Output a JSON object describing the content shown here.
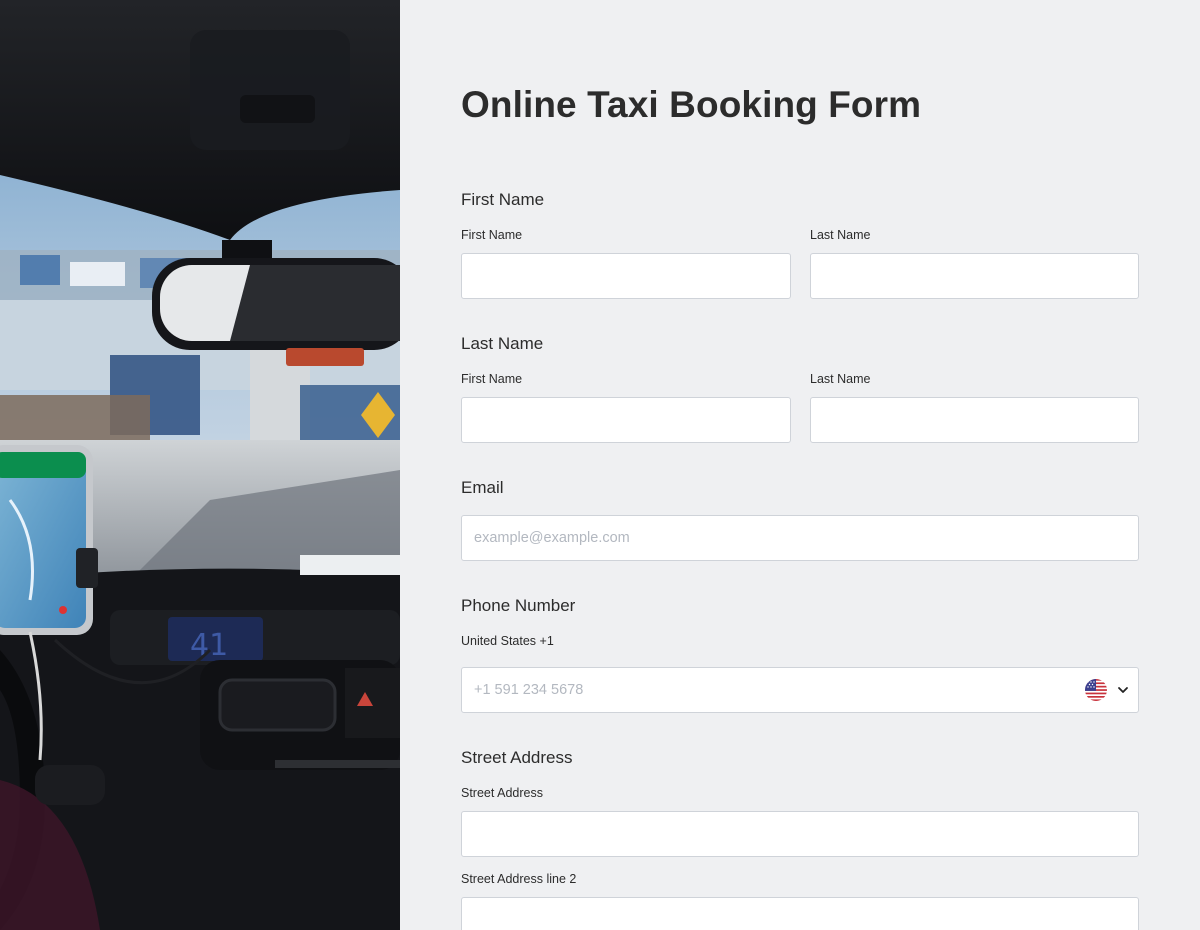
{
  "form": {
    "title": "Online Taxi Booking Form",
    "first_name_group": {
      "label": "First Name",
      "first_sublabel": "First Name",
      "last_sublabel": "Last Name",
      "first_value": "",
      "last_value": ""
    },
    "last_name_group": {
      "label": "Last Name",
      "first_sublabel": "First Name",
      "last_sublabel": "Last Name",
      "first_value": "",
      "last_value": ""
    },
    "email": {
      "label": "Email",
      "placeholder": "example@example.com",
      "value": ""
    },
    "phone": {
      "label": "Phone Number",
      "country_label": "United States +1",
      "placeholder": "+1 591 234 5678",
      "value": "",
      "country_icon": "us-flag-icon",
      "dropdown_icon": "chevron-down-icon"
    },
    "street": {
      "label": "Street Address",
      "line1_sublabel": "Street Address",
      "line2_sublabel": "Street Address line 2",
      "line1_value": "",
      "line2_value": ""
    }
  },
  "photo": {
    "description_icon": "taxi-interior-photo",
    "dashboard_readout": "41"
  },
  "colors": {
    "page_background": "#eff0f2",
    "field_background": "#ffffff",
    "field_border": "#cfd3d9",
    "text": "#2c2c2c",
    "placeholder": "#b3b8c0"
  }
}
